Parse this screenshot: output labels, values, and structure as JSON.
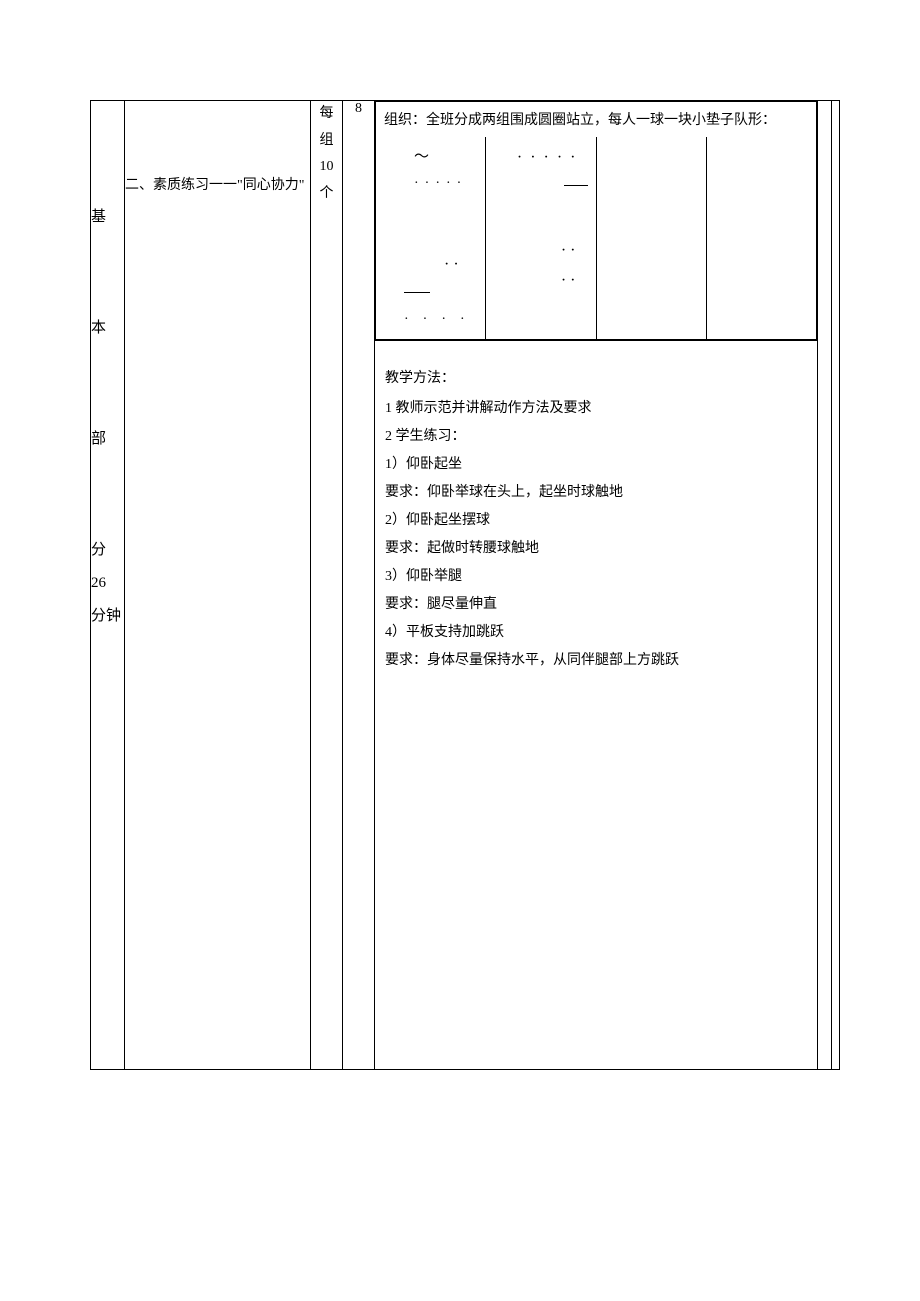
{
  "section": {
    "label_parts": [
      "基",
      "本",
      "部",
      "分 26",
      "分钟"
    ]
  },
  "activity": {
    "number_title": "二、素质练习一一\"同心协力\""
  },
  "reps": {
    "line1": "每",
    "line2": "组",
    "line3": "10",
    "line4": "个"
  },
  "time_value": "8",
  "organization": {
    "intro": "组织：全班分成两组围成圆圈站立，每人一球一块小垫子队形："
  },
  "methods": {
    "heading": "教学方法：",
    "line1": "1 教师示范并讲解动作方法及要求",
    "line2": "2 学生练习：",
    "item1": "1）仰卧起坐",
    "req1": "要求：仰卧举球在头上，起坐时球触地",
    "item2": "2）仰卧起坐摆球",
    "req2": "要求：起做时转腰球触地",
    "item3": "3）仰卧举腿",
    "req3": "要求：腿尽量伸直",
    "item4": "4）平板支持加跳跃",
    "req4": "要求：身体尽量保持水平，从同伴腿部上方跳跃"
  }
}
